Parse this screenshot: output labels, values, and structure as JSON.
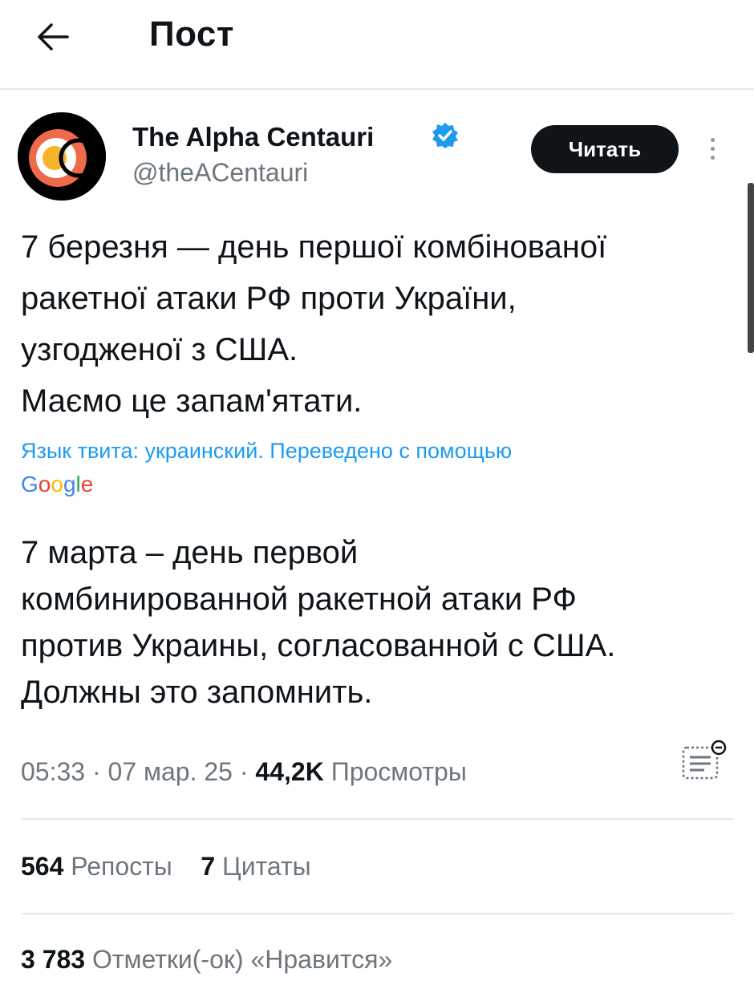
{
  "header": {
    "title": "Пост"
  },
  "author": {
    "name": "The Alpha Centauri",
    "handle": "@theACentauri",
    "follow_label": "Читать"
  },
  "tweet": {
    "lines": [
      "7 березня — день першої комбінованої",
      "ракетної атаки РФ проти України,",
      "узгодженої з США.",
      "Маємо це запам'ятати."
    ]
  },
  "translation": {
    "note": "Язык твита: украинский. Переведено с помощью",
    "provider": "Google",
    "lines": [
      "7 марта – день первой",
      "комбинированной ракетной атаки РФ",
      "против Украины, согласованной с США.",
      "Должны это запомнить."
    ]
  },
  "meta": {
    "time": "05:33",
    "date": "07 мар. 25",
    "views_count": "44,2K",
    "views_label": "Просмотры",
    "separator": "·"
  },
  "stats": {
    "reposts_count": "564",
    "reposts_label": "Репосты",
    "quotes_count": "7",
    "quotes_label": "Цитаты",
    "likes_count": "3 783",
    "likes_label": "Отметки(-ок) «Нравится»"
  },
  "icons": {
    "back": "arrow-left-icon",
    "verified": "verified-badge-icon",
    "more": "more-vertical-icon",
    "analytics": "analytics-icon"
  },
  "colors": {
    "accent": "#1d9bf0",
    "text": "#0f1419",
    "secondary": "#6e767d",
    "button_bg": "#0f1419"
  }
}
